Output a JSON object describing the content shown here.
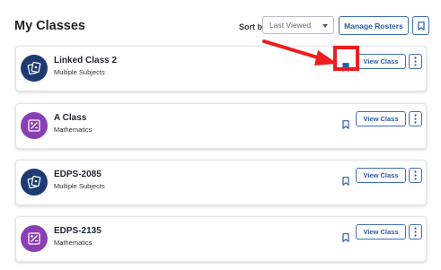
{
  "header": {
    "title": "My Classes",
    "sort_label": "Sort by",
    "sort_value": "Last Viewed",
    "manage_rosters_label": "Manage Rosters",
    "bookmark_icon": "bookmark-icon"
  },
  "classes": [
    {
      "name": "Linked Class 2",
      "subject": "Multiple Subjects",
      "avatar_color": "#1d3b71",
      "icon": "cards-icon",
      "bookmarked": true,
      "view_label": "View Class"
    },
    {
      "name": "A Class",
      "subject": "Mathematics",
      "avatar_color": "#8a3fb3",
      "icon": "math-icon",
      "bookmarked": false,
      "view_label": "View Class"
    },
    {
      "name": "EDPS-2085",
      "subject": "Multiple Subjects",
      "avatar_color": "#1d3b71",
      "icon": "cards-icon",
      "bookmarked": false,
      "view_label": "View Class"
    },
    {
      "name": "EDPS-2135",
      "subject": "Mathematics",
      "avatar_color": "#8a3fb3",
      "icon": "math-icon",
      "bookmarked": false,
      "view_label": "View Class"
    }
  ],
  "annotation": {
    "color": "#ee1c1c"
  },
  "colors": {
    "accent": "#2a5ca8",
    "border": "#3d6fb4"
  }
}
